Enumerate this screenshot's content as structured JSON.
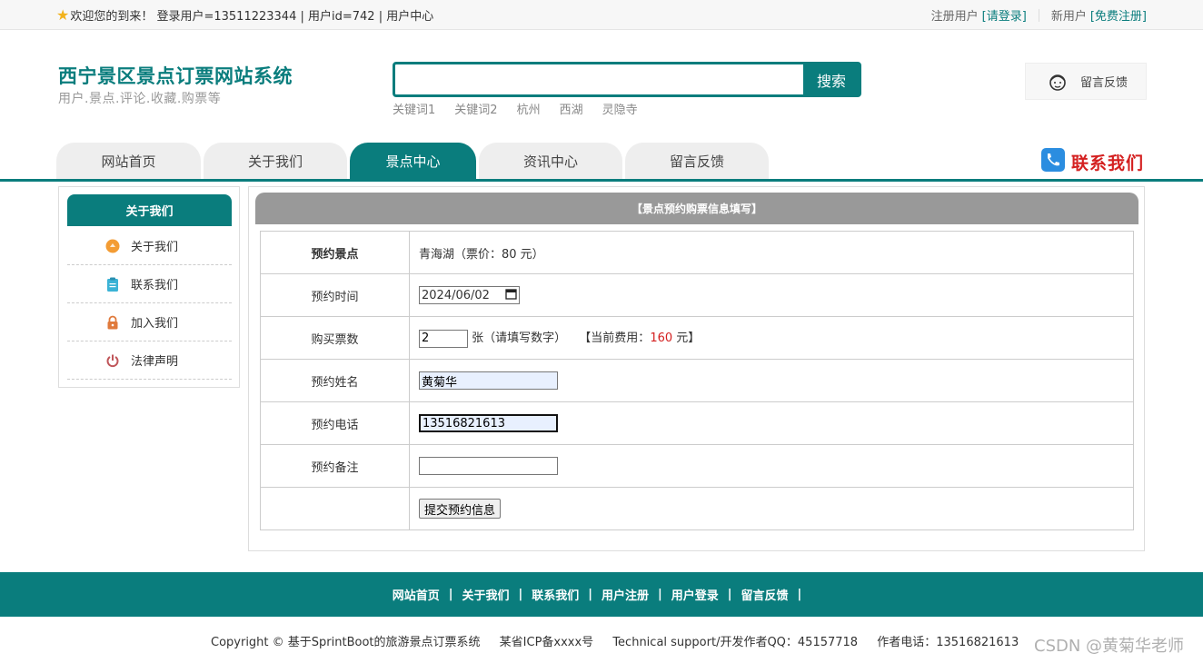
{
  "topbar": {
    "welcome": "欢迎您的到来！ 登录用户=13511223344 | 用户id=742 | 用户中心",
    "register_prefix": "注册用户",
    "login_link": "[请登录]",
    "new_user": "新用户",
    "signup_link": "[免费注册]"
  },
  "header": {
    "title": "西宁景区景点订票网站系统",
    "subtitle": "用户.景点.评论.收藏.购票等",
    "search_placeholder": "",
    "search_button": "搜索",
    "hotwords": [
      "关键词1",
      "关键词2",
      "杭州",
      "西湖",
      "灵隐寺"
    ],
    "feedback": "留言反馈"
  },
  "nav": {
    "tabs": [
      {
        "label": "网站首页"
      },
      {
        "label": "关于我们"
      },
      {
        "label": "景点中心"
      },
      {
        "label": "资讯中心"
      },
      {
        "label": "留言反馈"
      }
    ],
    "contact": "联系我们"
  },
  "sidebar": {
    "title": "关于我们",
    "items": [
      {
        "label": "关于我们",
        "icon": "orange-circle-icon"
      },
      {
        "label": "联系我们",
        "icon": "clipboard-icon"
      },
      {
        "label": "加入我们",
        "icon": "lock-icon"
      },
      {
        "label": "法律声明",
        "icon": "power-icon"
      }
    ]
  },
  "form": {
    "title": "【景点预约购票信息填写】",
    "spot_label": "预约景点",
    "spot_value": "青海湖（票价：80 元）",
    "date_label": "预约时间",
    "date_value": "2024/06/02",
    "count_label": "购买票数",
    "count_value": "2",
    "count_hint": "张（请填写数字）",
    "fee_prefix": "【当前费用：",
    "fee_value": "160",
    "fee_suffix": " 元】",
    "name_label": "预约姓名",
    "name_value": "黄菊华",
    "phone_label": "预约电话",
    "phone_value": "13516821613",
    "remark_label": "预约备注",
    "remark_value": "",
    "submit": "提交预约信息"
  },
  "footer": {
    "links": [
      "网站首页",
      "关于我们",
      "联系我们",
      "用户注册",
      "用户登录",
      "留言反馈"
    ],
    "copyright": "Copyright © 基于SprintBoot的旅游景点订票系统",
    "icp": "某省ICP备xxxx号",
    "support": "Technical support/开发作者QQ：45157718",
    "phone": "作者电话：13516821613"
  },
  "watermark": "CSDN @黄菊华老师",
  "colors": {
    "accent": "#0a7d7d",
    "red": "#d42020",
    "gray_header": "#999999"
  }
}
